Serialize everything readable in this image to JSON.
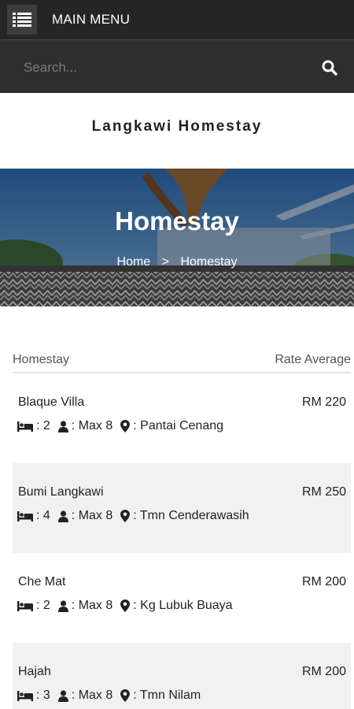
{
  "header": {
    "menu_label": "MAIN MENU",
    "menu_icon": "list-icon"
  },
  "search": {
    "placeholder": "Search...",
    "icon": "search-icon"
  },
  "site": {
    "title": "Langkawi Homestay"
  },
  "hero": {
    "title": "Homestay",
    "breadcrumb": [
      "Home",
      ">",
      "Homestay"
    ]
  },
  "table": {
    "col_left": "Homestay",
    "col_right": "Rate Average",
    "rows": [
      {
        "name": "Blaque Villa",
        "rate": "RM 220",
        "beds": ": 2",
        "guests": ": Max 8",
        "location": ": Pantai Cenang"
      },
      {
        "name": "Bumi Langkawi",
        "rate": "RM 250",
        "beds": ": 4",
        "guests": ": Max 8",
        "location": ": Tmn Cenderawasih"
      },
      {
        "name": "Che Mat",
        "rate": "RM 200",
        "beds": ": 2",
        "guests": ": Max 8",
        "location": ": Kg Lubuk Buaya"
      },
      {
        "name": "Hajah",
        "rate": "RM 200",
        "beds": ": 3",
        "guests": ": Max 8",
        "location": ": Tmn Nilam"
      }
    ]
  },
  "icons": {
    "bed": "bed-icon",
    "guests": "user-icon",
    "location": "map-marker-icon"
  },
  "colors": {
    "topbar": "#252525",
    "searchbar": "#2e2e2e",
    "row_alt": "#f1f1f1"
  }
}
